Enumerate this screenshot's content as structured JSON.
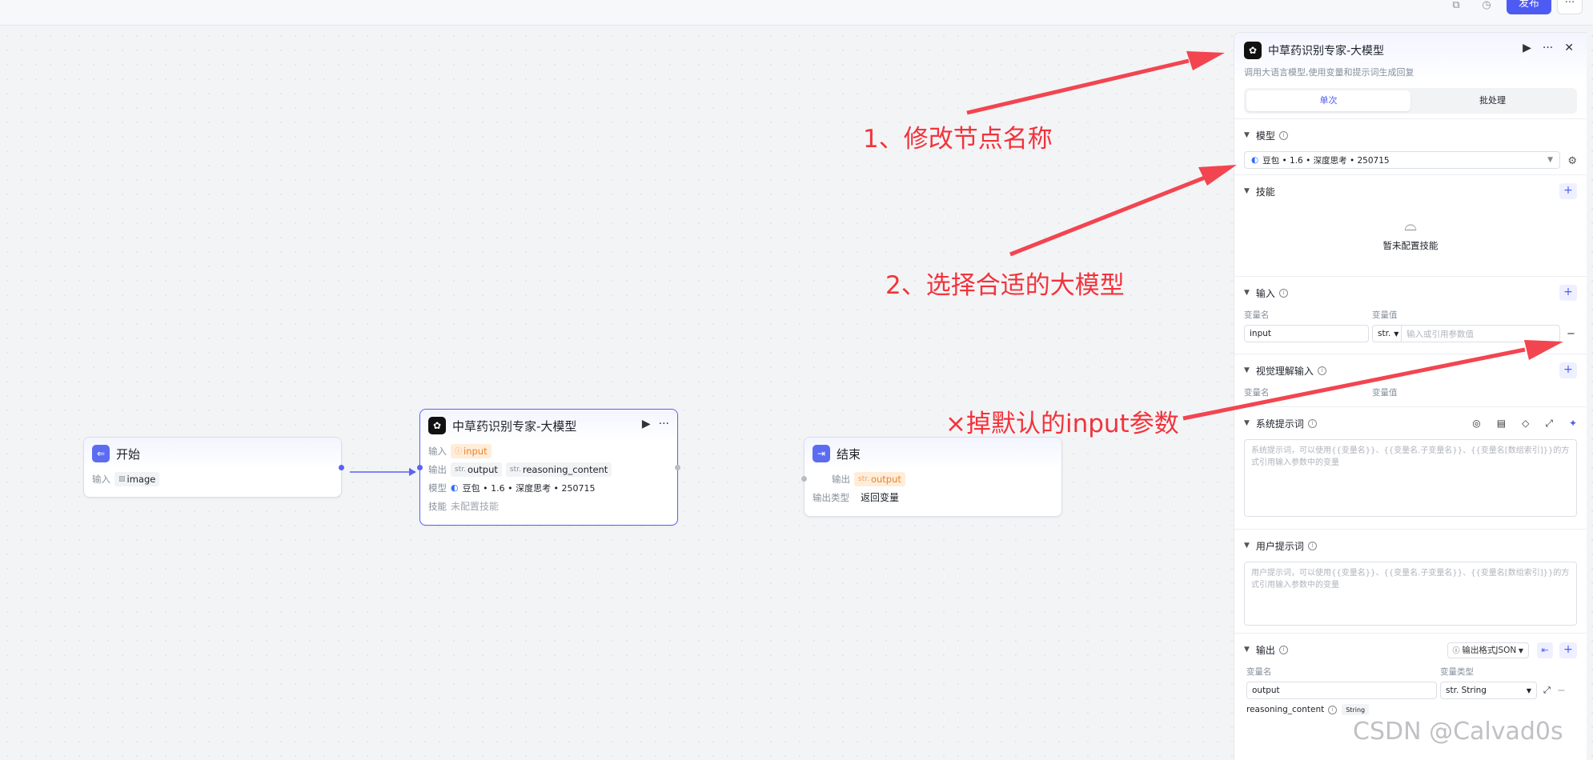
{
  "toolbar": {
    "publish_label": "发布",
    "more_label": "···"
  },
  "nodes": {
    "start": {
      "title": "开始",
      "input_label": "输入",
      "input_value": "image"
    },
    "llm": {
      "title": "中草药识别专家-大模型",
      "input_label": "输入",
      "input_value": "input",
      "output_label": "输出",
      "output_1": "output",
      "output_2": "reasoning_content",
      "model_label": "模型",
      "model_value": "豆包 • 1.6 • 深度思考 • 250715",
      "skill_label": "技能",
      "skill_value": "未配置技能",
      "type_prefix": "str."
    },
    "end": {
      "title": "结束",
      "output_label": "输出",
      "output_value": "output",
      "type_label": "输出类型",
      "type_value": "返回变量"
    }
  },
  "annotations": {
    "a1": "1、修改节点名称",
    "a2": "2、选择合适的大模型",
    "a3": "×掉默认的input参数",
    "color": "#f2333b"
  },
  "panel": {
    "title": "中草药识别专家-大模型",
    "subtitle": "调用大语言模型,使用变量和提示词生成回复",
    "tabs": {
      "single": "单次",
      "batch": "批处理"
    },
    "model": {
      "label": "模型",
      "value": "豆包 • 1.6 • 深度思考 • 250715"
    },
    "skills": {
      "label": "技能",
      "empty": "暂未配置技能"
    },
    "inputs": {
      "label": "输入",
      "col_name": "变量名",
      "col_value": "变量值",
      "name": "input",
      "type": "str.",
      "placeholder": "输入或引用参数值"
    },
    "vision": {
      "label": "视觉理解输入",
      "col_name": "变量名",
      "col_value": "变量值"
    },
    "system_prompt": {
      "label": "系统提示词",
      "placeholder": "系统提示词，可以使用{{变量名}}、{{变量名.子变量名}}、{{变量名[数组索引]}}的方式引用输入参数中的变量"
    },
    "user_prompt": {
      "label": "用户提示词",
      "placeholder": "用户提示词，可以使用{{变量名}}、{{变量名.子变量名}}、{{变量名[数组索引]}}的方式引用输入参数中的变量"
    },
    "output": {
      "label": "输出",
      "format": "输出格式JSON",
      "col_name": "变量名",
      "col_type": "变量类型",
      "name": "output",
      "type": "str. String",
      "second": "reasoning_content",
      "second_type": "String"
    }
  },
  "watermark": "CSDN @Calvad0s",
  "accent": "#4e5bf2"
}
